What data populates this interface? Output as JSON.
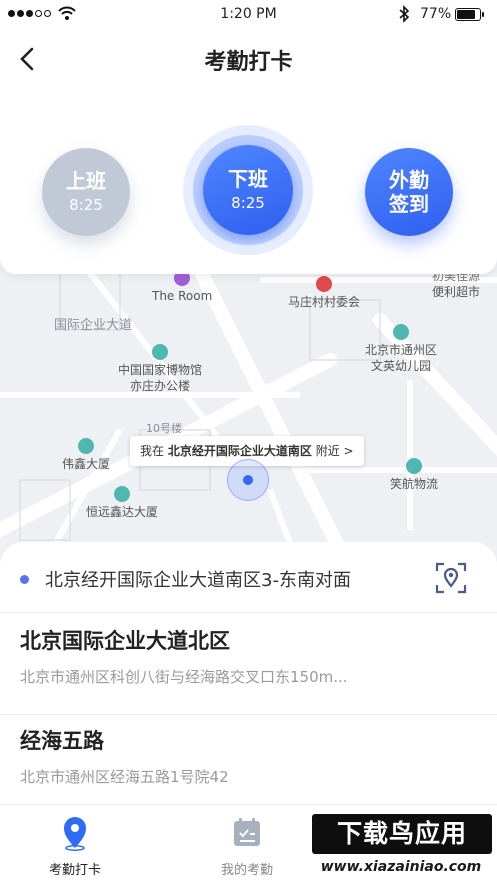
{
  "status_bar": {
    "time": "1:20 PM",
    "battery": "77%"
  },
  "header": {
    "title": "考勤打卡"
  },
  "punch": {
    "clock_in": {
      "label": "上班",
      "time": "8:25"
    },
    "clock_out": {
      "label": "下班",
      "time": "8:25"
    },
    "field": {
      "line1": "外勤",
      "line2": "签到"
    }
  },
  "map": {
    "pois": {
      "the_room": "The Room",
      "mazhuang": "马庄村村委会",
      "bianli": "便利超市",
      "bianli_top": "初美佳源",
      "road": "国际企业大道",
      "museum1": "中国国家博物馆",
      "museum2": "亦庄办公楼",
      "tongzhou1": "北京市通州区",
      "tongzhou2": "文英幼儿园",
      "bldg10": "10号楼",
      "weixin": "伟鑫大厦",
      "hengyuan": "恒远鑫达大厦",
      "xiaohang": "笑航物流"
    },
    "location_tip": {
      "prefix": "我在",
      "place": "北京经开国际企业大道南区",
      "suffix": "附近 >"
    }
  },
  "sheet": {
    "current_location": "北京经开国际企业大道南区3-东南对面",
    "places": [
      {
        "name": "北京国际企业大道北区",
        "address": "北京市通州区科创八街与经海路交叉口东150m..."
      },
      {
        "name": "经海五路",
        "address": "北京市通州区经海五路1号院42"
      }
    ]
  },
  "tabs": [
    {
      "label": "考勤打卡"
    },
    {
      "label": "我的考勤"
    }
  ],
  "watermark": {
    "top": "下载鸟应用",
    "bottom": "www.xiazainiao.com"
  },
  "colors": {
    "accent": "#3568f5",
    "inactive_button": "#c2c9d6"
  }
}
